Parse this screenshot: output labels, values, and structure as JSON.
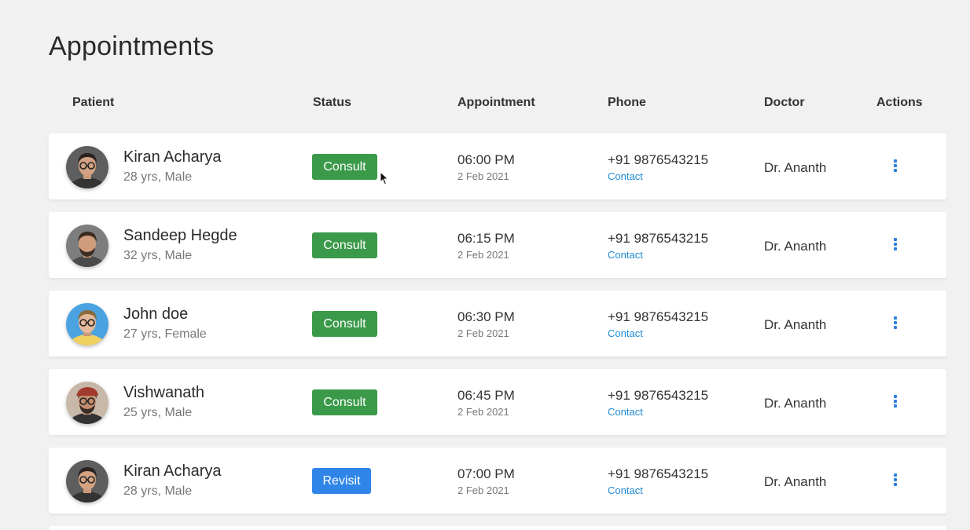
{
  "page": {
    "title": "Appointments"
  },
  "columns": {
    "patient": "Patient",
    "status": "Status",
    "appointment": "Appointment",
    "phone": "Phone",
    "doctor": "Doctor",
    "actions": "Actions"
  },
  "colors": {
    "consult": "#3b9a4a",
    "revisit": "#2f86e8",
    "link": "#1f8ad2",
    "action": "#2b7fe0"
  },
  "rows": [
    {
      "name": "Kiran Acharya",
      "meta": "28 yrs, Male",
      "status": "Consult",
      "status_type": "consult",
      "time": "06:00 PM",
      "date": "2 Feb 2021",
      "phone": "+91 9876543215",
      "contact": "Contact",
      "doctor": "Dr. Ananth",
      "avatar_icon": "man-glasses-avatar"
    },
    {
      "name": "Sandeep Hegde",
      "meta": "32 yrs, Male",
      "status": "Consult",
      "status_type": "consult",
      "time": "06:15 PM",
      "date": "2 Feb 2021",
      "phone": "+91 9876543215",
      "contact": "Contact",
      "doctor": "Dr. Ananth",
      "avatar_icon": "man-beard-avatar"
    },
    {
      "name": "John doe",
      "meta": "27 yrs, Female",
      "status": "Consult",
      "status_type": "consult",
      "time": "06:30 PM",
      "date": "2 Feb 2021",
      "phone": "+91 9876543215",
      "contact": "Contact",
      "doctor": "Dr. Ananth",
      "avatar_icon": "woman-sunglasses-avatar"
    },
    {
      "name": "Vishwanath",
      "meta": "25 yrs, Male",
      "status": "Consult",
      "status_type": "consult",
      "time": "06:45 PM",
      "date": "2 Feb 2021",
      "phone": "+91 9876543215",
      "contact": "Contact",
      "doctor": "Dr. Ananth",
      "avatar_icon": "man-cap-avatar"
    },
    {
      "name": "Kiran Acharya",
      "meta": "28 yrs, Male",
      "status": "Revisit",
      "status_type": "revisit",
      "time": "07:00 PM",
      "date": "2 Feb 2021",
      "phone": "+91 9876543215",
      "contact": "Contact",
      "doctor": "Dr. Ananth",
      "avatar_icon": "man-glasses-avatar"
    }
  ]
}
